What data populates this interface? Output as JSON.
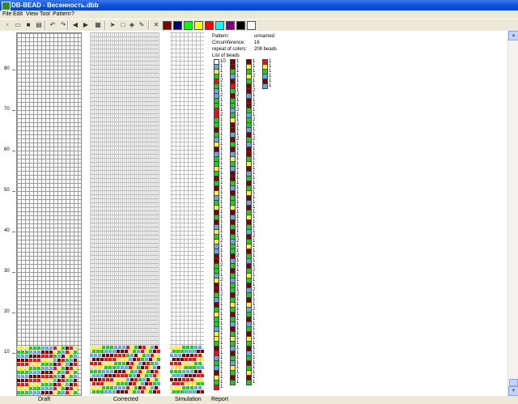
{
  "window": {
    "title": "DB-BEAD - Весенность.dbb"
  },
  "menu": [
    "File",
    "Edit",
    "View",
    "Tool",
    "Pattern",
    "?"
  ],
  "toolbar": {
    "tools": [
      {
        "name": "new-file-icon",
        "glyph": "▫"
      },
      {
        "name": "open-file-icon",
        "glyph": "▭"
      },
      {
        "name": "save-icon",
        "glyph": "■"
      },
      {
        "name": "print-icon",
        "glyph": "▤"
      },
      {
        "name": "undo-icon",
        "glyph": "↶"
      },
      {
        "name": "redo-icon",
        "glyph": "↷"
      },
      {
        "name": "arrow-left-icon",
        "glyph": "◀"
      },
      {
        "name": "arrow-right-icon",
        "glyph": "▶"
      },
      {
        "name": "copy-icon",
        "glyph": "▦"
      },
      {
        "name": "pointer-icon",
        "glyph": "➤"
      },
      {
        "name": "select-rect-icon",
        "glyph": "□"
      },
      {
        "name": "fill-icon",
        "glyph": "◈"
      },
      {
        "name": "picker-icon",
        "glyph": "✎"
      },
      {
        "name": "clear-icon",
        "glyph": "✕"
      }
    ],
    "palette": [
      "#7b0000",
      "#00007b",
      "#00ff00",
      "#ffff00",
      "#ff0000",
      "#00ffff",
      "#7b007b",
      "#000000",
      "#ffffff"
    ]
  },
  "ruler": {
    "labels": [
      "10",
      "20",
      "30",
      "40",
      "50",
      "60",
      "70",
      "80"
    ]
  },
  "report": {
    "pattern_label": "Pattern:",
    "pattern_value": "unnamed",
    "circ_label": "Circumference:",
    "circ_value": "16",
    "repeat_label": "repeat of colors:",
    "repeat_value": "208 beads",
    "list_label": "List of beads",
    "beads": [
      [
        [
          "#ffffff",
          "10"
        ],
        [
          "#66aadd",
          "1"
        ],
        [
          "#ffee44",
          "1"
        ],
        [
          "#22cc22",
          "1"
        ],
        [
          "#ee1111",
          "2"
        ],
        [
          "#22cc22",
          "1"
        ],
        [
          "#66aadd",
          "1"
        ],
        [
          "#66aadd",
          "2"
        ],
        [
          "#22cc22",
          "1"
        ],
        [
          "#22cc22",
          "1"
        ],
        [
          "#ee1111",
          "1"
        ],
        [
          "#ee1111",
          "2"
        ],
        [
          "#22cc22",
          "1"
        ],
        [
          "#22cc22",
          "1"
        ],
        [
          "#7b0000",
          "1"
        ],
        [
          "#22cc22",
          "1"
        ],
        [
          "#66aadd",
          "1"
        ],
        [
          "#ffee44",
          "1"
        ],
        [
          "#7b0000",
          "1"
        ],
        [
          "#66aadd",
          "1"
        ],
        [
          "#22cc22",
          "1"
        ],
        [
          "#22cc22",
          "1"
        ],
        [
          "#ffee44",
          "1"
        ],
        [
          "#22cc22",
          "1"
        ],
        [
          "#7b0000",
          "1"
        ],
        [
          "#22cc22",
          "1"
        ],
        [
          "#7b0000",
          "1"
        ],
        [
          "#ffee44",
          "1"
        ],
        [
          "#66aadd",
          "1"
        ],
        [
          "#22cc22",
          "1"
        ],
        [
          "#ffee44",
          "1"
        ],
        [
          "#7b0000",
          "1"
        ],
        [
          "#22cc22",
          "1"
        ],
        [
          "#7b0000",
          "1"
        ],
        [
          "#66aadd",
          "1"
        ],
        [
          "#ffee44",
          "1"
        ],
        [
          "#22cc22",
          "1"
        ],
        [
          "#ffee44",
          "2"
        ],
        [
          "#66aadd",
          "1"
        ],
        [
          "#66aadd",
          "1"
        ],
        [
          "#7b0000",
          "1"
        ],
        [
          "#7b0000",
          "1"
        ],
        [
          "#22cc22",
          "2"
        ],
        [
          "#22cc22",
          "1"
        ],
        [
          "#66aadd",
          "1"
        ],
        [
          "#ffee44",
          "2"
        ],
        [
          "#7b0000",
          "1"
        ],
        [
          "#7b0000",
          "1"
        ],
        [
          "#22cc22",
          "2"
        ],
        [
          "#66aadd",
          "1"
        ],
        [
          "#7b0000",
          "1"
        ],
        [
          "#22cc22",
          "1"
        ],
        [
          "#ffee44",
          "1"
        ],
        [
          "#22cc22",
          "1"
        ],
        [
          "#22cc22",
          "1"
        ],
        [
          "#66aadd",
          "1"
        ],
        [
          "#ffee44",
          "1"
        ],
        [
          "#ffee44",
          "1"
        ],
        [
          "#22cc22",
          "1"
        ],
        [
          "#7b0000",
          "1"
        ],
        [
          "#ee1111",
          "1"
        ],
        [
          "#66aadd",
          "1"
        ],
        [
          "#22cc22",
          "1"
        ],
        [
          "#66aadd",
          "1"
        ],
        [
          "#7b0000",
          "1"
        ],
        [
          "#ffee44",
          "1"
        ],
        [
          "#22cc22",
          "1"
        ],
        [
          "#ee1111",
          "1"
        ]
      ],
      [
        [
          "#7b0000",
          "1"
        ],
        [
          "#7b0000",
          "1"
        ],
        [
          "#22cc22",
          "1"
        ],
        [
          "#66aadd",
          "1"
        ],
        [
          "#7b0000",
          "1"
        ],
        [
          "#ee1111",
          "1"
        ],
        [
          "#22cc22",
          "1"
        ],
        [
          "#7b0000",
          "2"
        ],
        [
          "#22cc22",
          "1"
        ],
        [
          "#22cc22",
          "1"
        ],
        [
          "#66aadd",
          "2"
        ],
        [
          "#22cc22",
          "1"
        ],
        [
          "#ffee44",
          "1"
        ],
        [
          "#7b0000",
          "2"
        ],
        [
          "#7b0000",
          "1"
        ],
        [
          "#66aadd",
          "1"
        ],
        [
          "#7b0000",
          "2"
        ],
        [
          "#22cc22",
          "1"
        ],
        [
          "#7b0000",
          "1"
        ],
        [
          "#66aadd",
          "1"
        ],
        [
          "#ffee44",
          "1"
        ],
        [
          "#22cc22",
          "1"
        ],
        [
          "#66aadd",
          "1"
        ],
        [
          "#7b0000",
          "1"
        ],
        [
          "#7b0000",
          "1"
        ],
        [
          "#22cc22",
          "1"
        ],
        [
          "#66aadd",
          "1"
        ],
        [
          "#7b0000",
          "1"
        ],
        [
          "#22cc22",
          "1"
        ],
        [
          "#22cc22",
          "1"
        ],
        [
          "#ffee44",
          "1"
        ],
        [
          "#7b0000",
          "1"
        ],
        [
          "#66aadd",
          "1"
        ],
        [
          "#7b0000",
          "1"
        ],
        [
          "#22cc22",
          "1"
        ],
        [
          "#7b0000",
          "1"
        ],
        [
          "#22cc22",
          "1"
        ],
        [
          "#66aadd",
          "2"
        ],
        [
          "#22cc22",
          "1"
        ],
        [
          "#22cc22",
          "1"
        ],
        [
          "#7b0000",
          "2"
        ],
        [
          "#66aadd",
          "1"
        ],
        [
          "#22cc22",
          "1"
        ],
        [
          "#7b0000",
          "1"
        ],
        [
          "#22cc22",
          "1"
        ],
        [
          "#66aadd",
          "1"
        ],
        [
          "#22cc22",
          "1"
        ],
        [
          "#22cc22",
          "1"
        ],
        [
          "#7b0000",
          "2"
        ],
        [
          "#22cc22",
          "1"
        ],
        [
          "#ffee44",
          "1"
        ],
        [
          "#22cc22",
          "1"
        ],
        [
          "#7b0000",
          "1"
        ],
        [
          "#22cc22",
          "1"
        ],
        [
          "#66aadd",
          "1"
        ],
        [
          "#7b0000",
          "1"
        ],
        [
          "#22cc22",
          "1"
        ],
        [
          "#ffee44",
          "1"
        ],
        [
          "#22cc22",
          "1"
        ],
        [
          "#66aadd",
          "1"
        ],
        [
          "#7b0000",
          "1"
        ],
        [
          "#22cc22",
          "1"
        ],
        [
          "#66aadd",
          "1"
        ],
        [
          "#ffee44",
          "1"
        ],
        [
          "#22cc22",
          "1"
        ],
        [
          "#7b0000",
          "1"
        ],
        [
          "#22cc22",
          "1"
        ]
      ],
      [
        [
          "#7b0000",
          "1"
        ],
        [
          "#ffee44",
          "1"
        ],
        [
          "#22cc22",
          "1"
        ],
        [
          "#ffee44",
          "2"
        ],
        [
          "#22cc22",
          "1"
        ],
        [
          "#7b0000",
          "1"
        ],
        [
          "#7b0000",
          "2"
        ],
        [
          "#66aadd",
          "1"
        ],
        [
          "#7b0000",
          "1"
        ],
        [
          "#7b0000",
          "2"
        ],
        [
          "#22cc22",
          "1"
        ],
        [
          "#66aadd",
          "1"
        ],
        [
          "#22cc22",
          "2"
        ],
        [
          "#22cc22",
          "1"
        ],
        [
          "#66aadd",
          "1"
        ],
        [
          "#7b0000",
          "1"
        ],
        [
          "#22cc22",
          "2"
        ],
        [
          "#66aadd",
          "1"
        ],
        [
          "#7b0000",
          "1"
        ],
        [
          "#7b0000",
          "1"
        ],
        [
          "#22cc22",
          "1"
        ],
        [
          "#ffee44",
          "1"
        ],
        [
          "#7b0000",
          "1"
        ],
        [
          "#66aadd",
          "1"
        ],
        [
          "#22cc22",
          "1"
        ],
        [
          "#7b0000",
          "1"
        ],
        [
          "#22cc22",
          "1"
        ],
        [
          "#ffee44",
          "1"
        ],
        [
          "#7b0000",
          "1"
        ],
        [
          "#66aadd",
          "1"
        ],
        [
          "#7b0000",
          "1"
        ],
        [
          "#22cc22",
          "1"
        ],
        [
          "#ffee44",
          "1"
        ],
        [
          "#7b0000",
          "1"
        ],
        [
          "#22cc22",
          "1"
        ],
        [
          "#66aadd",
          "1"
        ],
        [
          "#7b0000",
          "2"
        ],
        [
          "#22cc22",
          "1"
        ],
        [
          "#ffee44",
          "1"
        ],
        [
          "#7b0000",
          "1"
        ],
        [
          "#22cc22",
          "1"
        ],
        [
          "#66aadd",
          "1"
        ],
        [
          "#7b0000",
          "1"
        ],
        [
          "#22cc22",
          "2"
        ],
        [
          "#ffee44",
          "1"
        ],
        [
          "#22cc22",
          "1"
        ],
        [
          "#7b0000",
          "1"
        ],
        [
          "#66aadd",
          "2"
        ],
        [
          "#22cc22",
          "1"
        ],
        [
          "#7b0000",
          "1"
        ],
        [
          "#ffee44",
          "1"
        ],
        [
          "#66aadd",
          "2"
        ],
        [
          "#22cc22",
          "1"
        ],
        [
          "#7b0000",
          "1"
        ],
        [
          "#66aadd",
          "1"
        ],
        [
          "#22cc22",
          "1"
        ],
        [
          "#7b0000",
          "1"
        ],
        [
          "#ffee44",
          "1"
        ],
        [
          "#22cc22",
          "1"
        ],
        [
          "#7b0000",
          "1"
        ],
        [
          "#66aadd",
          "1"
        ],
        [
          "#22cc22",
          "1"
        ],
        [
          "#7b0000",
          "1"
        ],
        [
          "#22cc22",
          "1"
        ],
        [
          "#ffee44",
          "1"
        ],
        [
          "#7b0000",
          "1"
        ],
        [
          "#22cc22",
          "1"
        ]
      ],
      [
        [
          "#ee1111",
          "1"
        ],
        [
          "#ffee44",
          "1"
        ],
        [
          "#22cc22",
          "1"
        ],
        [
          "#66aadd",
          "1"
        ],
        [
          "#7b0000",
          "1"
        ],
        [
          "#66aadd",
          "1"
        ]
      ]
    ]
  },
  "status": {
    "draft": "Draft",
    "corrected": "Corrected",
    "simulation": "Simulation",
    "report": "Report"
  }
}
